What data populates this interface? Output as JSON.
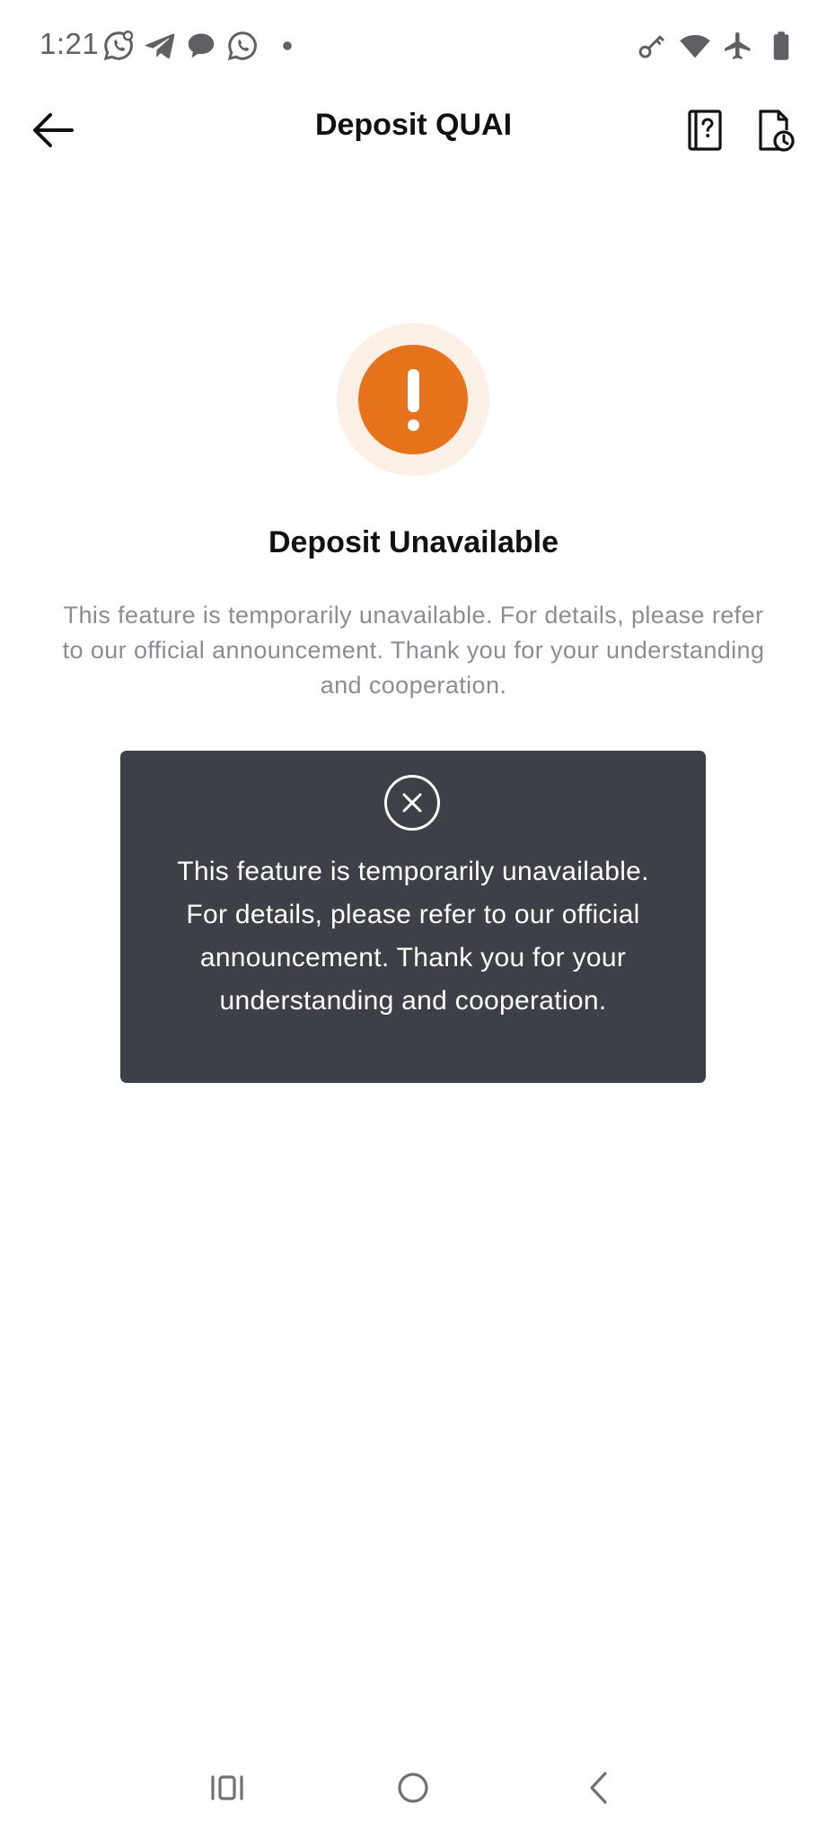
{
  "status_bar": {
    "time": "1:21",
    "left_icons": [
      "whatsapp-business-icon",
      "telegram-icon",
      "chat-bubble-icon",
      "whatsapp-icon",
      "dot-icon"
    ],
    "right_icons": [
      "vpn-key-icon",
      "wifi-icon",
      "airplane-mode-icon",
      "battery-icon"
    ]
  },
  "header": {
    "title": "Deposit QUAI",
    "back_icon": "arrow-left-icon",
    "help_icon": "help-book-icon",
    "history_icon": "history-document-icon"
  },
  "main": {
    "alert_icon": "exclamation-icon",
    "accent_color": "#e6721c",
    "heading": "Deposit Unavailable",
    "description": "This feature is temporarily unavailable. For details, please refer to our official announcement. Thank you for your understanding and cooperation."
  },
  "toast": {
    "icon": "close-circle-icon",
    "message": "This feature is temporarily unavailable. For details, please refer to our official announcement. Thank you for your understanding and cooperation.",
    "background": "#3d4046"
  },
  "nav_bar": {
    "icons": [
      "recent-apps-icon",
      "home-icon",
      "back-icon"
    ]
  }
}
